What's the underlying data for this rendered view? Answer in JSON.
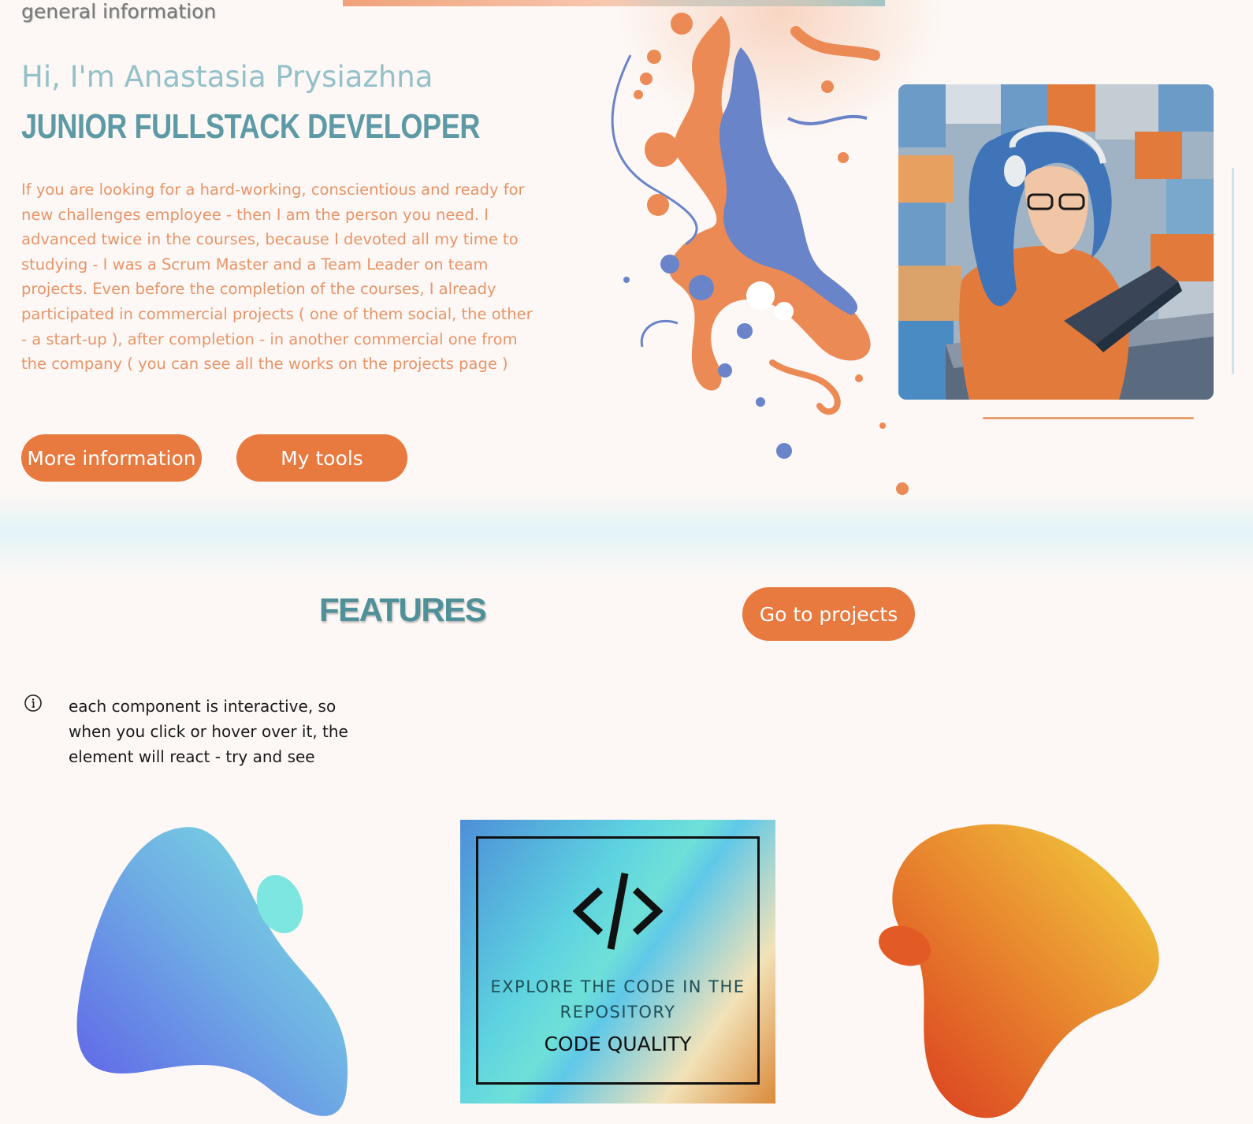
{
  "breadcrumb": "general information",
  "hero": {
    "greeting": "Hi, I'm Anastasia Prysiazhna",
    "role": "JUNIOR FULLSTACK DEVELOPER",
    "intro": "If you are looking for a hard-working, conscientious and ready for new challenges employee - then I am the person you need. I advanced twice in the courses, because I devoted all my time to studying - I was a Scrum Master and a Team Leader on team projects. Even before the completion of the courses, I already participated in commercial projects ( one of them social, the other - a start-up ), after completion - in another commercial one from the company ( you can see all the works on the projects page )",
    "buttons": {
      "more": "More information",
      "tools": "My tools"
    }
  },
  "features": {
    "title": "FEATURES",
    "go_to_projects": "Go to projects",
    "info_icon": "info-circle-icon",
    "info_text": "each component is interactive, so when you click or hover over it, the element will react - try and see",
    "code_card": {
      "icon": "code-brackets-icon",
      "caption": "EXPLORE THE CODE IN THE REPOSITORY",
      "label": "CODE QUALITY"
    }
  },
  "colors": {
    "accent_orange": "#e8793f",
    "teal_heading": "#5d9aa5",
    "intro_text": "#e89468",
    "background": "#fdf8f5"
  }
}
